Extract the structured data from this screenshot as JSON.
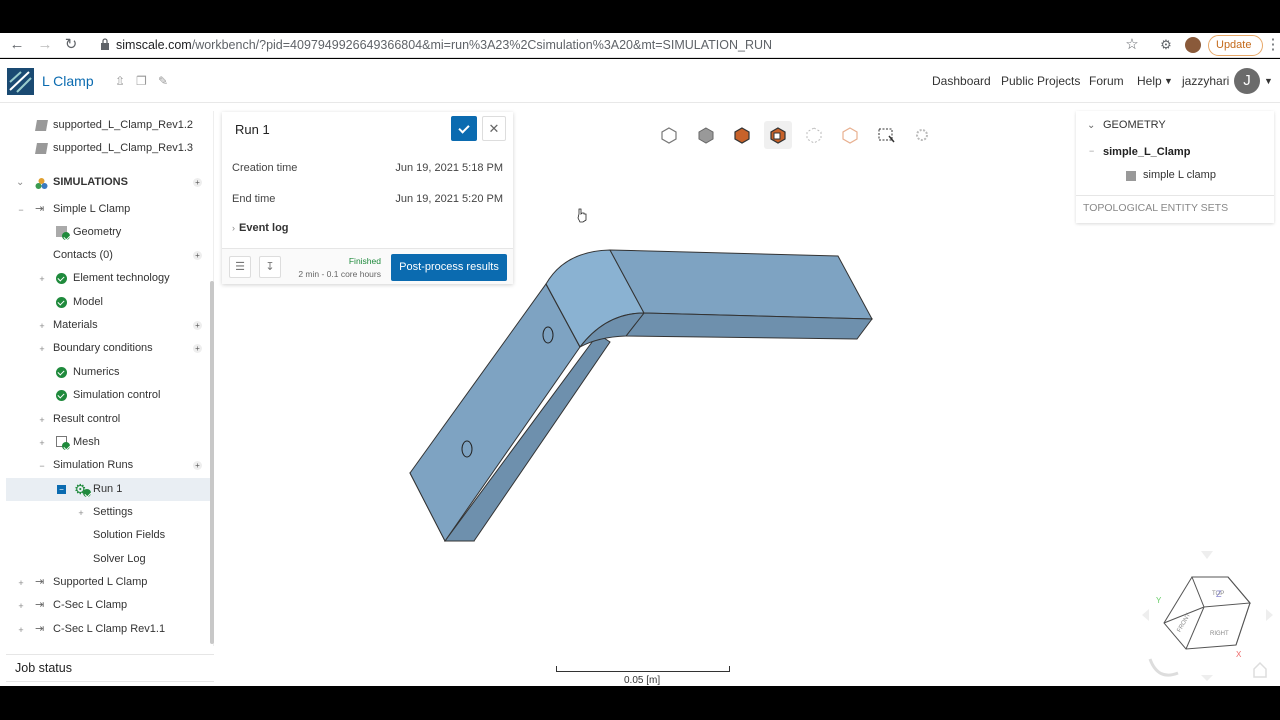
{
  "browser": {
    "url_host": "simscale.com",
    "url_path": "/workbench/?pid=4097949926649366804&mi=run%3A23%2Csimulation%3A20&mt=SIMULATION_RUN",
    "update_label": "Update"
  },
  "app": {
    "project_title": "L Clamp",
    "nav": [
      "Dashboard",
      "Public Projects",
      "Forum",
      "Help"
    ],
    "username": "jazzyhari",
    "avatar_initial": "J"
  },
  "tree": {
    "geometries": [
      "supported_L_Clamp_Rev1.2",
      "supported_L_Clamp_Rev1.3"
    ],
    "simulations_header": "SIMULATIONS",
    "simulation_name": "Simple L Clamp",
    "items": {
      "geometry": "Geometry",
      "contacts": "Contacts (0)",
      "element_technology": "Element technology",
      "model": "Model",
      "materials": "Materials",
      "boundary_conditions": "Boundary conditions",
      "numerics": "Numerics",
      "simulation_control": "Simulation control",
      "result_control": "Result control",
      "mesh": "Mesh",
      "simulation_runs": "Simulation Runs",
      "run": "Run 1",
      "settings": "Settings",
      "solution_fields": "Solution Fields",
      "solver_log": "Solver Log"
    },
    "other_simulations": [
      "Supported L Clamp",
      "C-Sec L Clamp",
      "C-Sec L Clamp Rev1.1"
    ]
  },
  "job_status": "Job status",
  "run_panel": {
    "title": "Run 1",
    "creation_label": "Creation time",
    "creation_value": "Jun 19, 2021 5:18 PM",
    "end_label": "End time",
    "end_value": "Jun 19, 2021 5:20 PM",
    "event_log": "Event log",
    "status": "Finished",
    "duration": "2 min - 0.1 core hours",
    "post_process": "Post-process results"
  },
  "geometry_panel": {
    "header": "GEOMETRY",
    "part_group": "simple_L_Clamp",
    "part": "simple L clamp",
    "entity_sets": "TOPOLOGICAL ENTITY SETS"
  },
  "viewport": {
    "scale_label": "0.05 [m]",
    "model_color": "#7ea3c2",
    "accent": "#0b6bb0"
  }
}
